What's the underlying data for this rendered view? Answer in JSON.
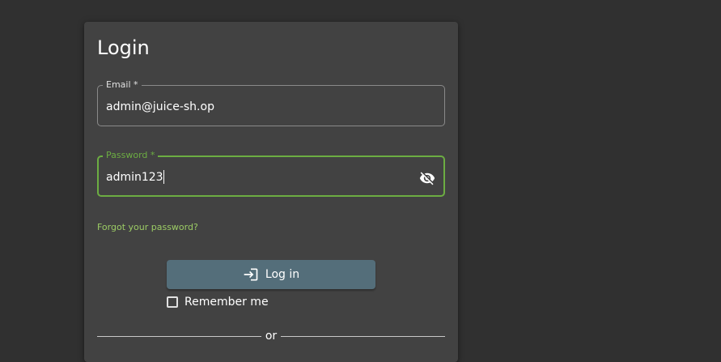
{
  "login": {
    "title": "Login",
    "email": {
      "label": "Email *",
      "value": "admin@juice-sh.op"
    },
    "password": {
      "label": "Password *",
      "value": "admin123",
      "toggle_icon": "visibility-off-icon"
    },
    "forgot_password": "Forgot your password?",
    "login_button": {
      "label": "Log in",
      "icon": "login-icon"
    },
    "remember_me": {
      "label": "Remember me",
      "checked": false
    },
    "divider": "or"
  },
  "colors": {
    "page_background": "#303030",
    "card_background": "#424242",
    "accent_green": "#6cad42",
    "link_green": "#9ccc65",
    "button_background": "#546e7a"
  }
}
